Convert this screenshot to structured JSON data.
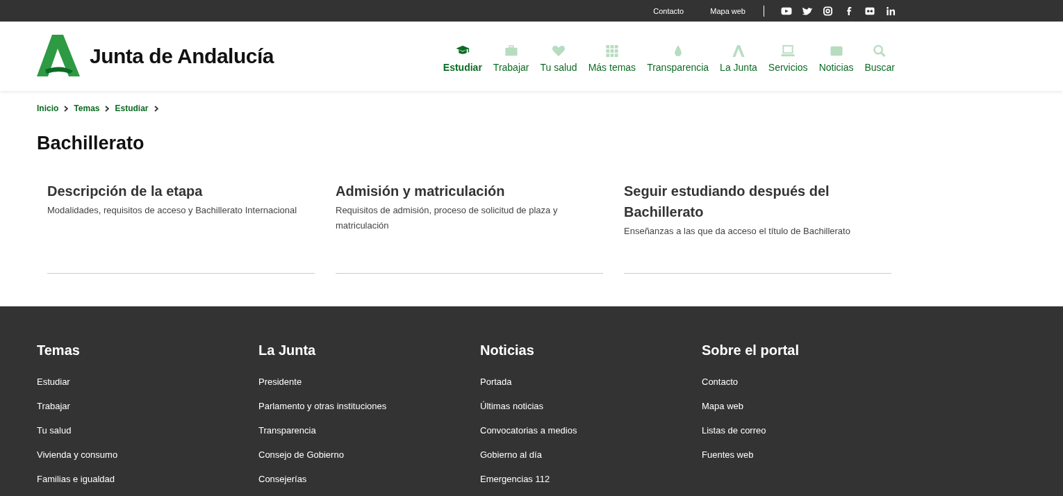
{
  "top_bar": {
    "links": [
      "Contacto",
      "Mapa web"
    ]
  },
  "header": {
    "logo_text": "Junta de Andalucía",
    "nav": [
      {
        "label": "Estudiar",
        "kind": "cap",
        "selected": true
      },
      {
        "label": "Trabajar",
        "kind": "case",
        "selected": false
      },
      {
        "label": "Tu salud",
        "kind": "heart",
        "selected": false
      },
      {
        "label": "Más temas",
        "kind": "grid",
        "selected": false
      },
      {
        "label": "Transparencia",
        "kind": "drop",
        "selected": false
      },
      {
        "label": "La Junta",
        "kind": "logo",
        "selected": false
      },
      {
        "label": "Servicios",
        "kind": "laptop",
        "selected": false
      },
      {
        "label": "Noticias",
        "kind": "news",
        "selected": false
      },
      {
        "label": "Buscar",
        "kind": "search",
        "selected": false
      }
    ]
  },
  "breadcrumb": [
    "Inicio",
    "Temas",
    "Estudiar"
  ],
  "title": "Bachillerato",
  "cards": [
    {
      "title": "Descripción de la etapa",
      "description": "Modalidades, requisitos de acceso y Bachillerato Internacional"
    },
    {
      "title": "Admisión y matriculación",
      "description": "Requisitos de admisión, proceso de solicitud de plaza y matriculación"
    },
    {
      "title": "Seguir estudiando después del Bachillerato",
      "description": "Enseñanzas a las que da acceso el título de Bachillerato"
    }
  ],
  "footer": {
    "columns": [
      {
        "heading": "Temas",
        "links": [
          "Estudiar",
          "Trabajar",
          "Tu salud",
          "Vivienda y consumo",
          "Familias e igualdad"
        ]
      },
      {
        "heading": "La Junta",
        "links": [
          "Presidente",
          "Parlamento y otras instituciones",
          "Transparencia",
          "Consejo de Gobierno",
          "Consejerías"
        ]
      },
      {
        "heading": "Noticias",
        "links": [
          "Portada",
          "Últimas noticias",
          "Convocatorias a medios",
          "Gobierno al día",
          "Emergencias 112"
        ]
      },
      {
        "heading": "Sobre el portal",
        "links": [
          "Contacto",
          "Mapa web",
          "Listas de correo",
          "Fuentes web"
        ]
      }
    ]
  }
}
